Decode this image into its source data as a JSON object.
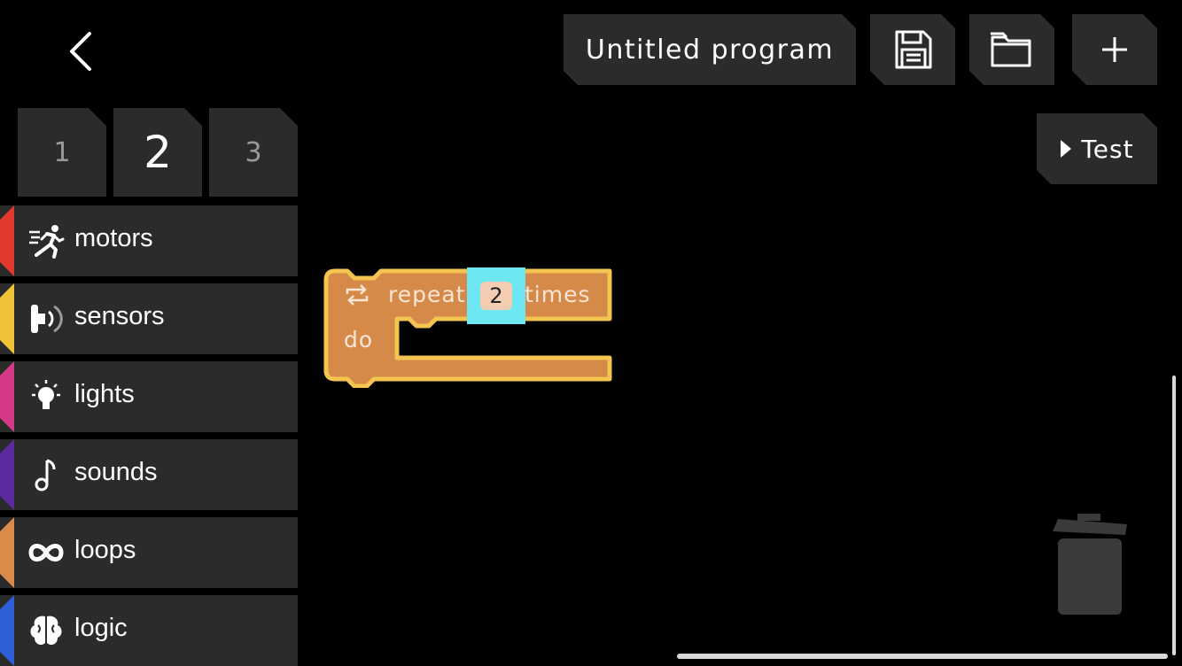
{
  "header": {
    "program_title": "Untitled program",
    "test_label": "Test"
  },
  "pages": [
    {
      "label": "1",
      "active": false
    },
    {
      "label": "2",
      "active": true
    },
    {
      "label": "3",
      "active": false
    }
  ],
  "categories": [
    {
      "label": "motors",
      "color": "#e03a2f",
      "icon": "running-person-icon"
    },
    {
      "label": "sensors",
      "color": "#f2c13a",
      "icon": "sensor-icon"
    },
    {
      "label": "lights",
      "color": "#d63a86",
      "icon": "light-bulb-icon"
    },
    {
      "label": "sounds",
      "color": "#5a2aa0",
      "icon": "music-note-icon"
    },
    {
      "label": "loops",
      "color": "#d98c4a",
      "icon": "infinity-icon"
    },
    {
      "label": "logic",
      "color": "#2f5fd8",
      "icon": "brain-icon"
    }
  ],
  "block": {
    "type": "repeat",
    "repeat_word": "repeat",
    "times_word": "times",
    "do_word": "do",
    "count": "2",
    "fill_color": "#d68a4a",
    "border_color": "#f3c450"
  },
  "colors": {
    "background": "#000000",
    "button": "#2b2b2b",
    "highlight": "#6fe7f2"
  }
}
